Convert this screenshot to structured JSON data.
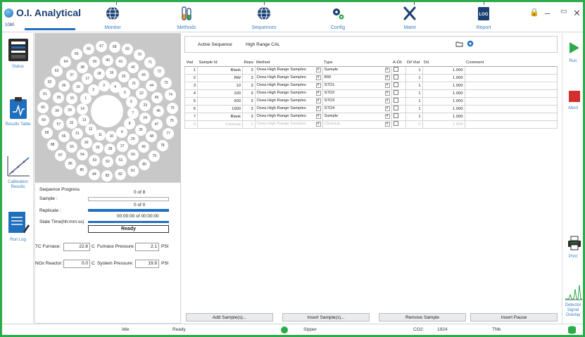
{
  "app": {
    "title": "O.I. Analytical",
    "serial": "1080"
  },
  "nav": [
    {
      "label": "Monitor",
      "icon": "monitor-globe-icon"
    },
    {
      "label": "Methods",
      "icon": "flask-icon"
    },
    {
      "label": "Sequences",
      "icon": "sequences-globe-icon"
    },
    {
      "label": "Config",
      "icon": "gears-icon"
    },
    {
      "label": "Maint",
      "icon": "tools-icon"
    },
    {
      "label": "Report",
      "icon": "log-icon",
      "badge": "LOG"
    }
  ],
  "leftbar": [
    {
      "label": "Status",
      "icon": "instrument-icon"
    },
    {
      "label": "Results Table",
      "icon": "clipboard-chart-icon"
    },
    {
      "label": "Calibration Results",
      "icon": "calibration-curve-icon"
    },
    {
      "label": "Run Log",
      "icon": "notepad-icon"
    }
  ],
  "rightbar": [
    {
      "label": "Run",
      "icon": "play-icon"
    },
    {
      "label": "Abort",
      "icon": "stop-icon"
    },
    {
      "label": "Print",
      "icon": "printer-icon"
    },
    {
      "label": "Detector Signal Overlay",
      "icon": "signal-icon"
    }
  ],
  "carousel": {
    "positions": [
      "1",
      "2",
      "3",
      "4",
      "5",
      "6",
      "7",
      "8",
      "9",
      "10",
      "11",
      "12",
      "13",
      "14",
      "15",
      "16",
      "17",
      "18",
      "19",
      "20",
      "21",
      "22",
      "23",
      "24",
      "25",
      "26",
      "27",
      "28",
      "29",
      "30",
      "31",
      "32",
      "33",
      "34",
      "35",
      "36",
      "37",
      "38",
      "39",
      "40",
      "41",
      "42",
      "43",
      "44",
      "45",
      "46",
      "47",
      "48",
      "49",
      "50",
      "51",
      "52",
      "53",
      "54",
      "55",
      "56",
      "57",
      "58",
      "59",
      "60",
      "61",
      "62",
      "63",
      "64",
      "65",
      "66",
      "67",
      "68",
      "69",
      "70",
      "71",
      "72",
      "73",
      "74",
      "75",
      "76",
      "77",
      "78",
      "79",
      "80",
      "81",
      "82",
      "83",
      "84",
      "85",
      "86",
      "87",
      "88"
    ]
  },
  "progress": {
    "heading": "Sequence Progress",
    "sample_label": "Sample :",
    "sample_value": "0 of 8",
    "replicate_label": "Replicate :",
    "replicate_value": "0 of 0",
    "time_label": "State Time(hh:mm:ss)",
    "time_value": "00:00:00 of 00:00:00",
    "state": "Ready"
  },
  "readings": {
    "tc_furnace_label": "TC Furnace:",
    "tc_furnace_value": "22.8",
    "tc_furnace_unit": "C",
    "furnace_pressure_label": "Furnace Pressure:",
    "furnace_pressure_value": "2.1",
    "furnace_pressure_unit": "PSI",
    "nox_reactor_label": "NOx Reactor:",
    "nox_reactor_value": "0.0",
    "nox_reactor_unit": "C",
    "system_pressure_label": "System Pressure:",
    "system_pressure_value": "19.9",
    "system_pressure_unit": "PSI"
  },
  "sequence": {
    "active_label": "Active Sequence",
    "active_value": "High Range CAL",
    "columns": [
      "Vial",
      "Sample Id",
      "Reps",
      "Method",
      "Type",
      "A-Dil",
      "Dil Vial",
      "Dil.",
      "Comment"
    ],
    "rows": [
      {
        "vial": "1",
        "sample_id": "Blank",
        "reps": "3",
        "method": "Oxea High Range Samples",
        "type": "Sample",
        "dil_vial": "1",
        "dil": "1.000"
      },
      {
        "vial": "2",
        "sample_id": "RW",
        "reps": "3",
        "method": "Oxea High Range Samples",
        "type": "RW",
        "dil_vial": "1",
        "dil": "1.000"
      },
      {
        "vial": "3",
        "sample_id": "10",
        "reps": "3",
        "method": "Oxea High Range Samples",
        "type": "STD1",
        "dil_vial": "1",
        "dil": "1.000"
      },
      {
        "vial": "4",
        "sample_id": "100",
        "reps": "3",
        "method": "Oxea High Range Samples",
        "type": "STD2",
        "dil_vial": "1",
        "dil": "1.000"
      },
      {
        "vial": "5",
        "sample_id": "500",
        "reps": "3",
        "method": "Oxea High Range Samples",
        "type": "STD3",
        "dil_vial": "1",
        "dil": "1.000"
      },
      {
        "vial": "6",
        "sample_id": "1000",
        "reps": "3",
        "method": "Oxea High Range Samples",
        "type": "STD4",
        "dil_vial": "1",
        "dil": "1.000"
      },
      {
        "vial": "7",
        "sample_id": "Blank",
        "reps": "3",
        "method": "Oxea High Range Samples",
        "type": "Sample",
        "dil_vial": "1",
        "dil": "1.000"
      },
      {
        "vial": "0",
        "sample_id": "Cleanup",
        "reps": "3",
        "method": "Oxea High Range Samples",
        "type": "CleanUp",
        "dil_vial": "0",
        "dil": "1.000"
      }
    ],
    "buttons": {
      "add": "Add Sample(s)...",
      "insert": "Insert Sample(s)...",
      "remove": "Remove Sample",
      "pause": "Insert Pause"
    }
  },
  "status": {
    "state": "Idle",
    "ready": "Ready",
    "sipper": "Sipper",
    "co2_label": "CO2:",
    "co2_value": "1924",
    "tnb_label": "TNb"
  },
  "colors": {
    "accent_blue": "#1f6fbf",
    "frame_green": "#2cab4a",
    "run_green": "#2cab4a",
    "abort_red": "#d32f2f"
  }
}
